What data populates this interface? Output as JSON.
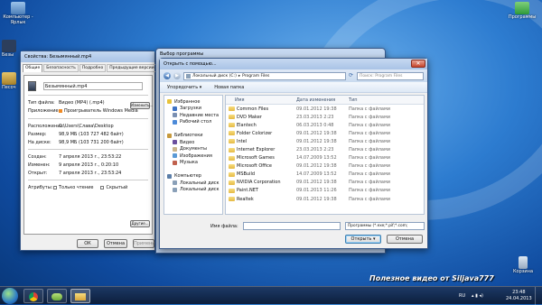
{
  "desktop": {
    "icons": [
      {
        "label": "Компьютер - Ярлык"
      },
      {
        "label": "Программы"
      },
      {
        "label": "Безы"
      },
      {
        "label": "Песоч"
      },
      {
        "label": "Корзина"
      }
    ],
    "watermark": "Полезное видео от Siljava777"
  },
  "props": {
    "title": "Свойства: Безымянный.mp4",
    "tabs": [
      "Общие",
      "Безопасность",
      "Подробно",
      "Предыдущие версии"
    ],
    "filename": "Безымянный.mp4",
    "rows": [
      {
        "label": "Тип файла:",
        "value": "Видео (MP4) (.mp4)"
      },
      {
        "label": "Приложение:",
        "value": "Проигрыватель Windows Media"
      },
      {
        "label": "Расположение:",
        "value": "C:\\Users\\Слава\\Desktop"
      },
      {
        "label": "Размер:",
        "value": "98,9 МБ (103 727 482 байт)"
      },
      {
        "label": "На диске:",
        "value": "98,9 МБ (103 731 200 байт)"
      },
      {
        "label": "Создан:",
        "value": "7 апреля 2013 г., 23:53:22"
      },
      {
        "label": "Изменен:",
        "value": "9 апреля 2013 г., 0:20:10"
      },
      {
        "label": "Открыт:",
        "value": "7 апреля 2013 г., 23:53:24"
      }
    ],
    "attr_label": "Атрибуты:",
    "readonly": "Только чтение",
    "hidden": "Скрытый",
    "other_btn": "Другие...",
    "change_btn": "Изменить...",
    "ok": "ОК",
    "cancel": "Отмена",
    "apply": "Применить"
  },
  "choose": {
    "title": "Выбор программы"
  },
  "open": {
    "title": "Открыть с помощью...",
    "crumbs": [
      "Локальный диск (C:)",
      "Program Files"
    ],
    "search_placeholder": "Поиск: Program Files",
    "organize": "Упорядочить ▾",
    "new_folder": "Новая папка",
    "tree": [
      {
        "label": "Избранное",
        "color": "#e8c33a"
      },
      {
        "label": "Загрузки",
        "color": "#3d72c4"
      },
      {
        "label": "Недавние места",
        "color": "#7a8fb2"
      },
      {
        "label": "Рабочий стол",
        "color": "#4c8ad8"
      },
      {
        "label": "",
        "color": ""
      },
      {
        "label": "Библиотеки",
        "color": "#c79a3e"
      },
      {
        "label": "Видео",
        "color": "#6a4f9e"
      },
      {
        "label": "Документы",
        "color": "#c9b48a"
      },
      {
        "label": "Изображения",
        "color": "#5a9ad6"
      },
      {
        "label": "Музыка",
        "color": "#c0614e"
      },
      {
        "label": "",
        "color": ""
      },
      {
        "label": "Компьютер",
        "color": "#5b7ea8"
      },
      {
        "label": "Локальный диск",
        "color": "#8aa0b8"
      },
      {
        "label": "Локальный диск",
        "color": "#8aa0b8"
      }
    ],
    "columns": [
      "Имя",
      "Дата изменения",
      "Тип"
    ],
    "files": [
      {
        "name": "Common Files",
        "date": "09.01.2012 19:38",
        "type": "Папка с файлами"
      },
      {
        "name": "DVD Maker",
        "date": "23.03.2013 2:23",
        "type": "Папка с файлами"
      },
      {
        "name": "Elantech",
        "date": "06.03.2013 0:48",
        "type": "Папка с файлами"
      },
      {
        "name": "Folder Colorizer",
        "date": "09.01.2012 19:38",
        "type": "Папка с файлами"
      },
      {
        "name": "Intel",
        "date": "09.01.2012 19:38",
        "type": "Папка с файлами"
      },
      {
        "name": "Internet Explorer",
        "date": "23.03.2013 2:23",
        "type": "Папка с файлами"
      },
      {
        "name": "Microsoft Games",
        "date": "14.07.2009 13:52",
        "type": "Папка с файлами"
      },
      {
        "name": "Microsoft Office",
        "date": "09.01.2012 19:38",
        "type": "Папка с файлами"
      },
      {
        "name": "MSBuild",
        "date": "14.07.2009 13:52",
        "type": "Папка с файлами"
      },
      {
        "name": "NVIDIA Corporation",
        "date": "09.01.2012 19:38",
        "type": "Папка с файлами"
      },
      {
        "name": "Paint.NET",
        "date": "09.01.2013 11:26",
        "type": "Папка с файлами"
      },
      {
        "name": "Realtek",
        "date": "09.01.2012 19:38",
        "type": "Папка с файлами"
      }
    ],
    "filename_label": "Имя файла:",
    "filename_value": "",
    "filter": "Программы (*.exe;*.pif;*.com;",
    "open_btn": "Открыть",
    "cancel_btn": "Отмена"
  },
  "taskbar": {
    "lang": "RU",
    "time": "23:48",
    "date": "24.04.2013"
  }
}
